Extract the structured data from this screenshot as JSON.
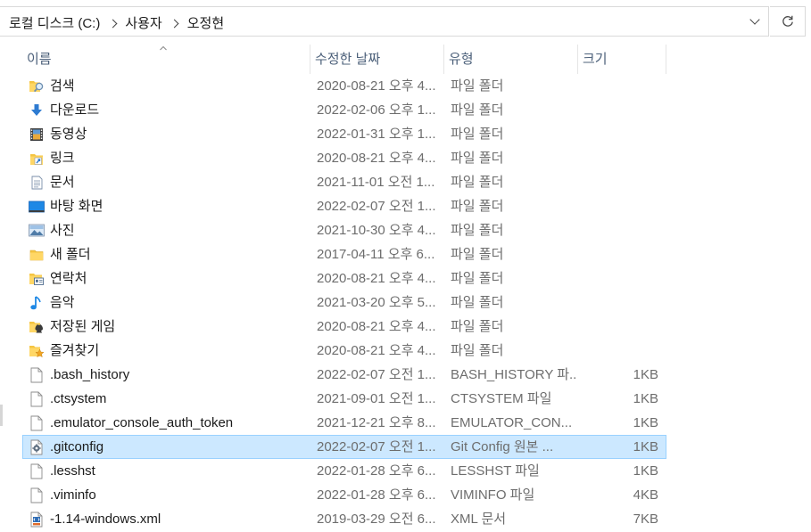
{
  "address": {
    "crumbs": [
      "로컬 디스크 (C:)",
      "사용자",
      "오정현"
    ]
  },
  "columns": {
    "name": "이름",
    "date": "수정한 날짜",
    "type": "유형",
    "size": "크기"
  },
  "files": [
    {
      "name": "검색",
      "date": "2020-08-21 오후 4...",
      "type": "파일 폴더",
      "size": "",
      "icon": "search-folder-icon"
    },
    {
      "name": "다운로드",
      "date": "2022-02-06 오후 1...",
      "type": "파일 폴더",
      "size": "",
      "icon": "download-folder-icon"
    },
    {
      "name": "동영상",
      "date": "2022-01-31 오후 1...",
      "type": "파일 폴더",
      "size": "",
      "icon": "video-folder-icon"
    },
    {
      "name": "링크",
      "date": "2020-08-21 오후 4...",
      "type": "파일 폴더",
      "size": "",
      "icon": "links-folder-icon"
    },
    {
      "name": "문서",
      "date": "2021-11-01 오전 1...",
      "type": "파일 폴더",
      "size": "",
      "icon": "documents-folder-icon"
    },
    {
      "name": "바탕 화면",
      "date": "2022-02-07 오전 1...",
      "type": "파일 폴더",
      "size": "",
      "icon": "desktop-folder-icon"
    },
    {
      "name": "사진",
      "date": "2021-10-30 오후 4...",
      "type": "파일 폴더",
      "size": "",
      "icon": "pictures-folder-icon"
    },
    {
      "name": "새 폴더",
      "date": "2017-04-11 오후 6...",
      "type": "파일 폴더",
      "size": "",
      "icon": "folder-icon"
    },
    {
      "name": "연락처",
      "date": "2020-08-21 오후 4...",
      "type": "파일 폴더",
      "size": "",
      "icon": "contacts-folder-icon"
    },
    {
      "name": "음악",
      "date": "2021-03-20 오후 5...",
      "type": "파일 폴더",
      "size": "",
      "icon": "music-folder-icon"
    },
    {
      "name": "저장된 게임",
      "date": "2020-08-21 오후 4...",
      "type": "파일 폴더",
      "size": "",
      "icon": "saved-games-folder-icon"
    },
    {
      "name": "즐겨찾기",
      "date": "2020-08-21 오후 4...",
      "type": "파일 폴더",
      "size": "",
      "icon": "favorites-folder-icon"
    },
    {
      "name": ".bash_history",
      "date": "2022-02-07 오전 1...",
      "type": "BASH_HISTORY 파...",
      "size": "1KB",
      "icon": "file-icon"
    },
    {
      "name": ".ctsystem",
      "date": "2021-09-01 오전 1...",
      "type": "CTSYSTEM 파일",
      "size": "1KB",
      "icon": "file-icon"
    },
    {
      "name": ".emulator_console_auth_token",
      "date": "2021-12-21 오후 8...",
      "type": "EMULATOR_CON...",
      "size": "1KB",
      "icon": "file-icon"
    },
    {
      "name": ".gitconfig",
      "date": "2022-02-07 오전 1...",
      "type": "Git Config 원본 ...",
      "size": "1KB",
      "icon": "config-file-icon",
      "selected": true
    },
    {
      "name": ".lesshst",
      "date": "2022-01-28 오후 6...",
      "type": "LESSHST 파일",
      "size": "1KB",
      "icon": "file-icon"
    },
    {
      "name": ".viminfo",
      "date": "2022-01-28 오후 6...",
      "type": "VIMINFO 파일",
      "size": "4KB",
      "icon": "file-icon"
    },
    {
      "name": "-1.14-windows.xml",
      "date": "2019-03-29 오전 6...",
      "type": "XML 문서",
      "size": "7KB",
      "icon": "xml-file-icon"
    }
  ]
}
